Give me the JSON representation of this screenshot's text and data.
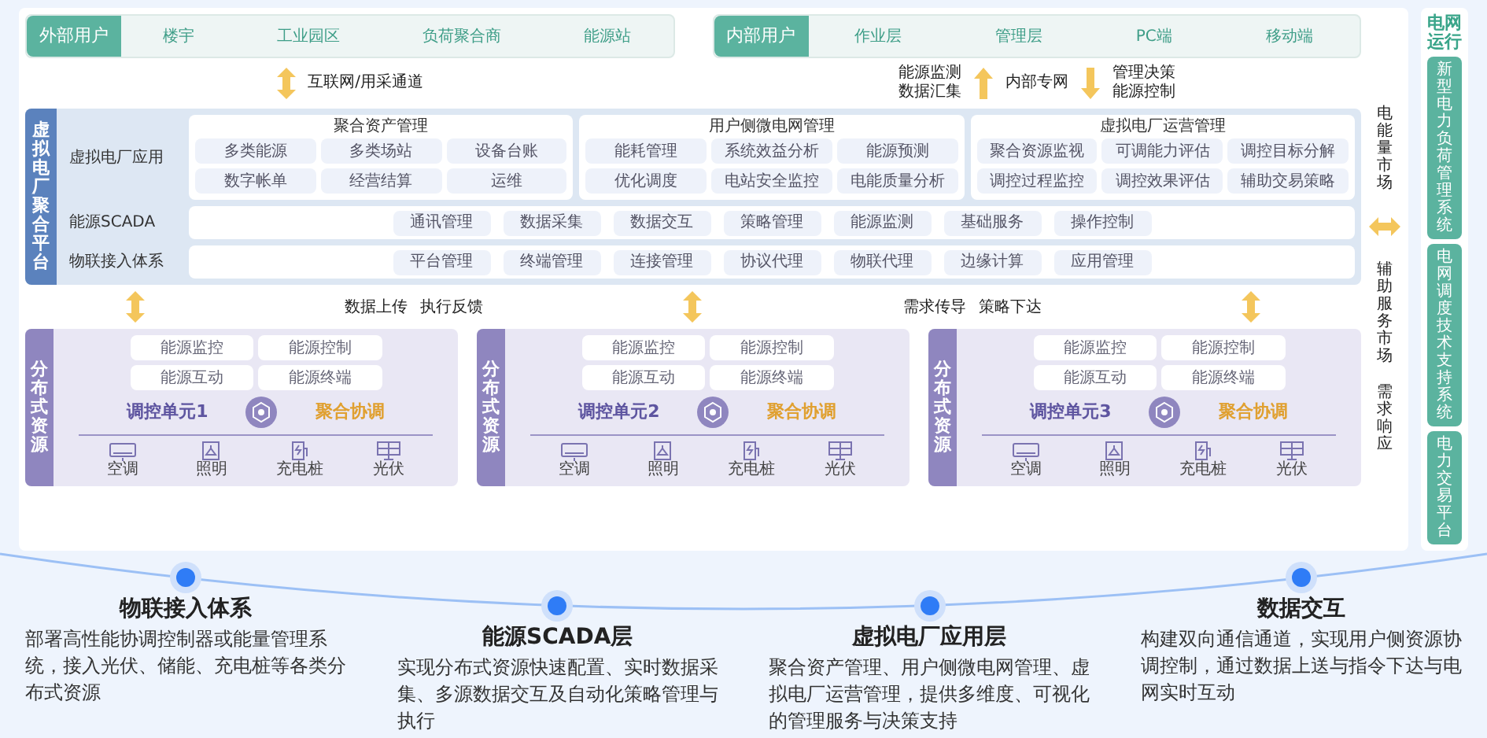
{
  "external_users": {
    "label": "外部用户",
    "items": [
      "楼宇",
      "工业园区",
      "负荷聚合商",
      "能源站"
    ]
  },
  "internal_users": {
    "label": "内部用户",
    "items": [
      "作业层",
      "管理层",
      "PC端",
      "移动端"
    ]
  },
  "external_links": [
    {
      "kind": "double-arrow"
    },
    {
      "kind": "text",
      "lines": [
        "互联网/用采通道"
      ]
    }
  ],
  "internal_links": [
    {
      "kind": "text",
      "lines": [
        "能源监测",
        "数据汇集"
      ]
    },
    {
      "kind": "up-arrow"
    },
    {
      "kind": "text",
      "lines": [
        "内部专网"
      ]
    },
    {
      "kind": "down-arrow"
    },
    {
      "kind": "text",
      "lines": [
        "管理决策",
        "能源控制"
      ]
    }
  ],
  "platform": {
    "title": "虚拟电厂聚合平台",
    "layers": [
      {
        "kind": "groups",
        "label": "虚拟电厂应用",
        "groups": [
          {
            "title": "聚合资产管理",
            "items": [
              "多类能源",
              "多类场站",
              "设备台账",
              "数字帐单",
              "经营结算",
              "运维"
            ]
          },
          {
            "title": "用户侧微电网管理",
            "items": [
              "能耗管理",
              "系统效益分析",
              "能源预测",
              "优化调度",
              "电站安全监控",
              "电能质量分析"
            ]
          },
          {
            "title": "虚拟电厂运营管理",
            "items": [
              "聚合资源监视",
              "可调能力评估",
              "调控目标分解",
              "调控过程监控",
              "调控效果评估",
              "辅助交易策略"
            ]
          }
        ]
      },
      {
        "kind": "row",
        "label": "能源SCADA",
        "items": [
          "通讯管理",
          "数据采集",
          "数据交互",
          "策略管理",
          "能源监测",
          "基础服务",
          "操作控制"
        ]
      },
      {
        "kind": "row",
        "label": "物联接入体系",
        "items": [
          "平台管理",
          "终端管理",
          "连接管理",
          "协议代理",
          "物联代理",
          "边缘计算",
          "应用管理"
        ]
      }
    ]
  },
  "middle_links": [
    {
      "kind": "double-arrow"
    },
    {
      "kind": "labels",
      "texts": [
        "数据上传",
        "执行反馈"
      ]
    },
    {
      "kind": "double-arrow"
    },
    {
      "kind": "labels",
      "texts": [
        "需求传导",
        "策略下达"
      ]
    },
    {
      "kind": "double-arrow"
    }
  ],
  "resources": [
    {
      "title": "分布式资源",
      "functions": [
        "能源监控",
        "能源控制",
        "能源互动",
        "能源终端"
      ],
      "unit": "调控单元1",
      "coordination": "聚合协调",
      "devices": [
        {
          "kind": "ac",
          "label": "空调"
        },
        {
          "kind": "light",
          "label": "照明"
        },
        {
          "kind": "charger",
          "label": "充电桩"
        },
        {
          "kind": "solar",
          "label": "光伏"
        }
      ]
    },
    {
      "title": "分布式资源",
      "functions": [
        "能源监控",
        "能源控制",
        "能源互动",
        "能源终端"
      ],
      "unit": "调控单元2",
      "coordination": "聚合协调",
      "devices": [
        {
          "kind": "ac",
          "label": "空调"
        },
        {
          "kind": "light",
          "label": "照明"
        },
        {
          "kind": "charger",
          "label": "充电桩"
        },
        {
          "kind": "solar",
          "label": "光伏"
        }
      ]
    },
    {
      "title": "分布式资源",
      "functions": [
        "能源监控",
        "能源控制",
        "能源互动",
        "能源终端"
      ],
      "unit": "调控单元3",
      "coordination": "聚合协调",
      "devices": [
        {
          "kind": "ac",
          "label": "空调"
        },
        {
          "kind": "light",
          "label": "照明"
        },
        {
          "kind": "charger",
          "label": "充电桩"
        },
        {
          "kind": "solar",
          "label": "光伏"
        }
      ]
    }
  ],
  "markets": [
    {
      "kind": "label",
      "text": "电能量市场"
    },
    {
      "kind": "double-arrow"
    },
    {
      "kind": "label",
      "text": "辅助服务市场"
    },
    {
      "kind": "label",
      "text": "需求响应"
    }
  ],
  "grid": {
    "title": "电网运行",
    "systems": [
      "新型电力负荷管理系统",
      "电网调度技术支持系统",
      "电力交易平台"
    ]
  },
  "features": [
    {
      "title": "物联接入体系",
      "text": "部署高性能协调控制器或能量管理系统，接入光伏、储能、充电桩等各类分布式资源"
    },
    {
      "title": "能源SCADA层",
      "text": "实现分布式资源快速配置、实时数据采集、多源数据交互及自动化策略管理与执行"
    },
    {
      "title": "虚拟电厂应用层",
      "text": "聚合资产管理、用户侧微电网管理、虚拟电厂运营管理，提供多维度、可视化的管理服务与决策支持"
    },
    {
      "title": "数据交互",
      "text": "构建双向通信通道，实现用户侧资源协调控制，通过数据上送与指令下达与电网实时互动"
    }
  ]
}
